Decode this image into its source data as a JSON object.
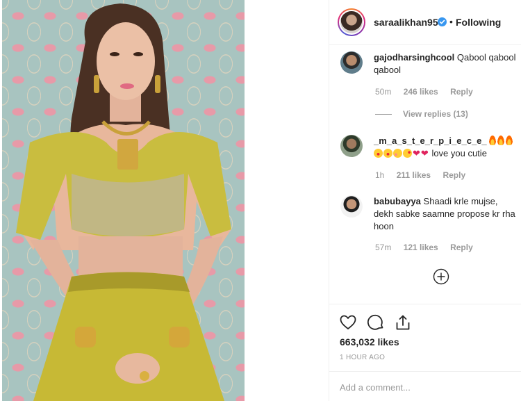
{
  "post": {
    "image_name": "post-photo",
    "author": "saraalikhan95",
    "verified": true,
    "separator": "•",
    "follow_status": "Following"
  },
  "comments": [
    {
      "user": "gajodharsinghcool",
      "text": "Qabool qabool qabool",
      "time": "50m",
      "likes": "246 likes",
      "reply": "Reply",
      "view_replies": "View replies (13)"
    },
    {
      "user": "_m_a_s_t_e_r_p_i_e_c_e_",
      "text": "love you cutie",
      "emojis": [
        "fire",
        "fire",
        "fire",
        "heart-eyes",
        "heart-eyes",
        "blush",
        "kiss",
        "heart",
        "heart"
      ],
      "time": "1h",
      "likes": "211 likes",
      "reply": "Reply"
    },
    {
      "user": "babubayya",
      "text": "Shaadi krle mujse, dekh sabke saamne propose kr rha hoon",
      "time": "57m",
      "likes": "121 likes",
      "reply": "Reply"
    }
  ],
  "actions": {
    "like_icon": "heart-outline-icon",
    "comment_icon": "comment-icon",
    "share_icon": "share-icon",
    "load_more_icon": "plus-circle-icon"
  },
  "likes_count": "663,032 likes",
  "time_ago": "1 HOUR AGO",
  "add_comment": {
    "placeholder": "Add a comment..."
  },
  "colors": {
    "text": "#262626",
    "muted": "#999999",
    "divider": "#efefef",
    "verified": "#3897f0",
    "heart": "#e0245e"
  }
}
